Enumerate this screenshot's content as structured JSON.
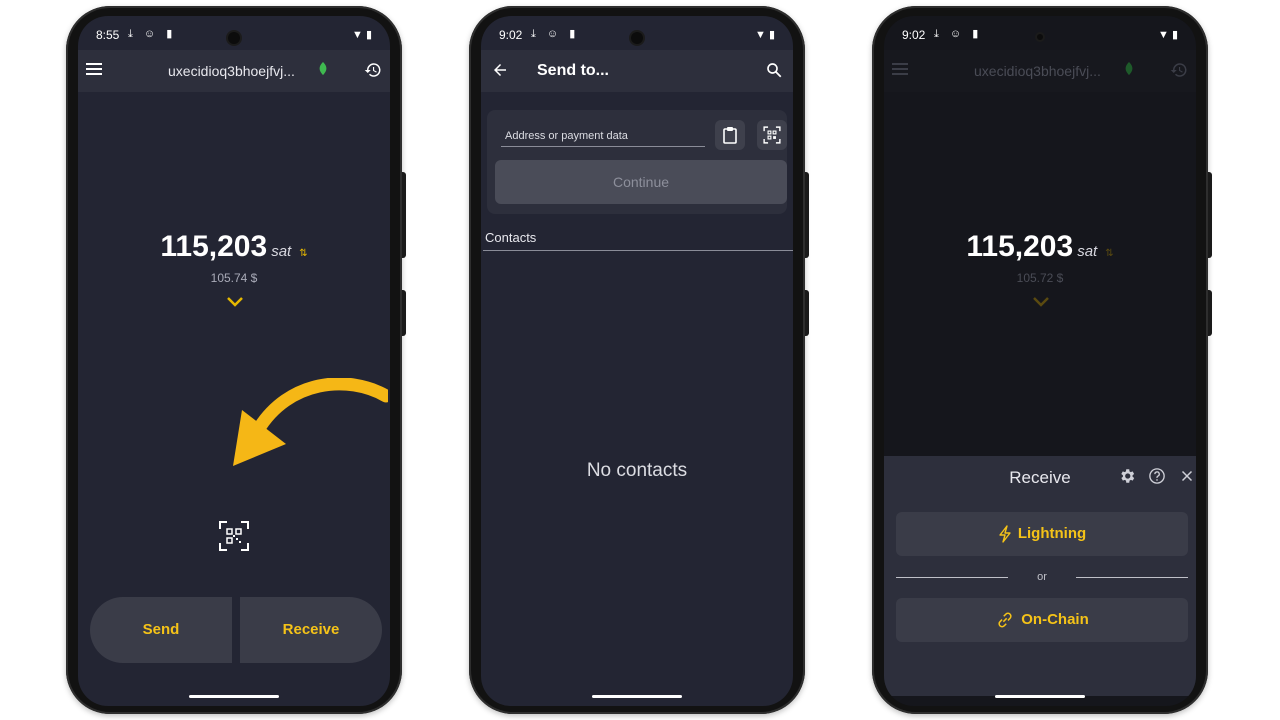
{
  "phone1": {
    "status": {
      "time": "8:55"
    },
    "wallet_name": "uxecidioq3bhoejfvj...",
    "balance": {
      "amount": "115,203",
      "unit": "sat",
      "fiat": "105.74 $"
    },
    "send_label": "Send",
    "receive_label": "Receive",
    "accent_color": "#f5c318"
  },
  "phone2": {
    "status": {
      "time": "9:02"
    },
    "title": "Send to...",
    "address_placeholder": "Address or payment data",
    "continue_label": "Continue",
    "contacts_label": "Contacts",
    "empty_label": "No contacts"
  },
  "phone3": {
    "status": {
      "time": "9:02"
    },
    "wallet_name": "uxecidioq3bhoejfvj...",
    "balance": {
      "amount": "115,203",
      "unit": "sat",
      "fiat": "105.72 $"
    },
    "sheet": {
      "title": "Receive",
      "lightning_label": "Lightning",
      "or_label": "or",
      "onchain_label": "On-Chain"
    }
  },
  "icons": [
    "menu-icon",
    "leaf-icon",
    "history-icon",
    "swap-icon",
    "chevron-down-icon",
    "qr-scan-icon",
    "back-arrow-icon",
    "search-icon",
    "clipboard-icon",
    "settings-icon",
    "help-icon",
    "close-icon",
    "lightning-icon",
    "link-icon"
  ]
}
